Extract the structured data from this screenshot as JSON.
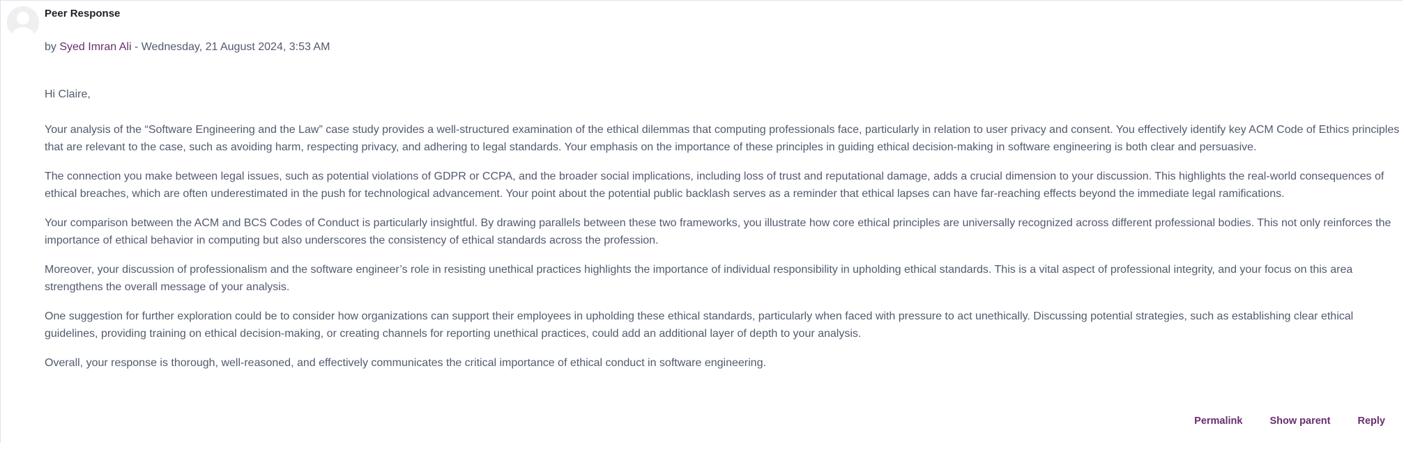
{
  "post": {
    "subject": "Peer Response",
    "by_prefix": "by ",
    "author": "Syed Imran Ali",
    "date_separator": " - ",
    "date": "Wednesday, 21 August 2024, 3:53 AM",
    "greeting": "Hi Claire,",
    "paragraphs": [
      "Your analysis of the “Software Engineering and the Law” case study provides a well-structured examination of the ethical dilemmas that computing professionals face, particularly in relation to user privacy and consent. You effectively identify key ACM Code of Ethics principles that are relevant to the case, such as avoiding harm, respecting privacy, and adhering to legal standards. Your emphasis on the importance of these principles in guiding ethical decision-making in software engineering is both clear and persuasive.",
      "The connection you make between legal issues, such as potential violations of GDPR or CCPA, and the broader social implications, including loss of trust and reputational damage, adds a crucial dimension to your discussion. This highlights the real-world consequences of ethical breaches, which are often underestimated in the push for technological advancement. Your point about the potential public backlash serves as a reminder that ethical lapses can have far-reaching effects beyond the immediate legal ramifications.",
      "Your comparison between the ACM and BCS Codes of Conduct is particularly insightful. By drawing parallels between these two frameworks, you illustrate how core ethical principles are universally recognized across different professional bodies. This not only reinforces the importance of ethical behavior in computing but also underscores the consistency of ethical standards across the profession.",
      "Moreover, your discussion of professionalism and the software engineer’s role in resisting unethical practices highlights the importance of individual responsibility in upholding ethical standards. This is a vital aspect of professional integrity, and your focus on this area strengthens the overall message of your analysis.",
      "One suggestion for further exploration could be to consider how organizations can support their employees in upholding these ethical standards, particularly when faced with pressure to act unethically. Discussing potential strategies, such as establishing clear ethical guidelines, providing training on ethical decision-making, or creating channels for reporting unethical practices, could add an additional layer of depth to your analysis.",
      "Overall, your response is thorough, well-reasoned, and effectively communicates the critical importance of ethical conduct in software engineering."
    ],
    "avatar_icon": "user-avatar-icon"
  },
  "actions": {
    "permalink": "Permalink",
    "show_parent": "Show parent",
    "reply": "Reply"
  },
  "colors": {
    "link": "#6a2d6f",
    "text": "#525a6e",
    "border": "#dde2ee"
  }
}
